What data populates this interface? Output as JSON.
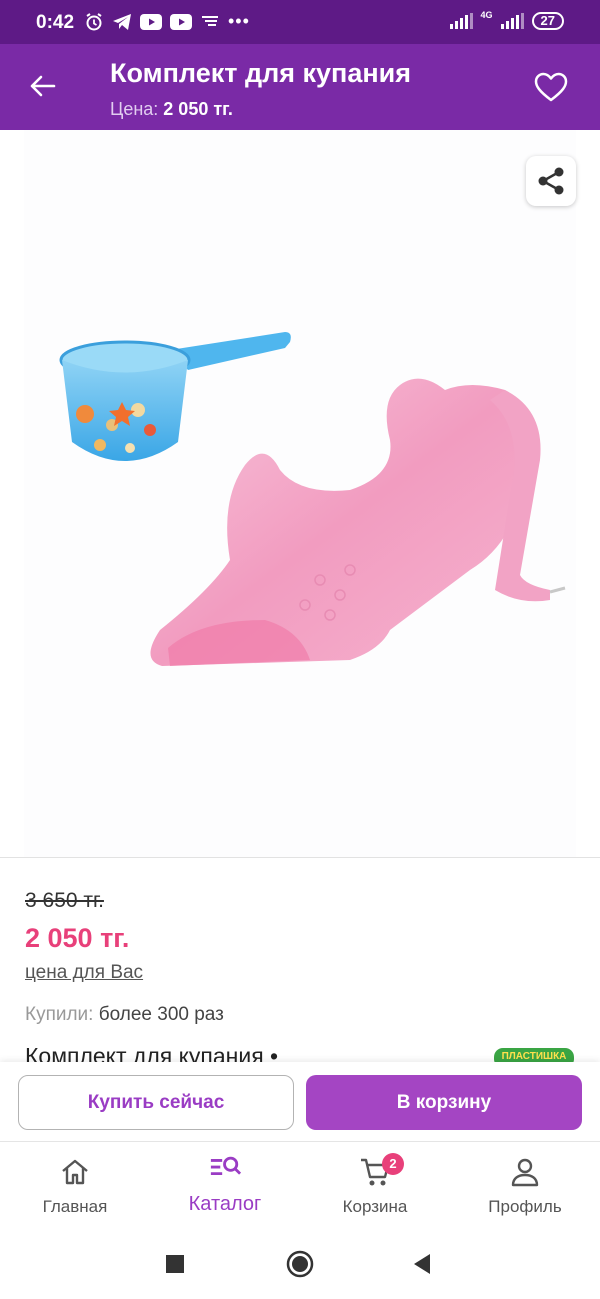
{
  "status_bar": {
    "time": "0:42",
    "left_icons": [
      "alarm-icon",
      "telegram-icon",
      "youtube-icon",
      "youtube-icon",
      "app-icon",
      "more-dots-icon"
    ],
    "network_label": "4G",
    "battery": "27"
  },
  "header": {
    "title": "Комплект для купания",
    "price_label": "Цена:",
    "price_value": "2 050 тг."
  },
  "product": {
    "old_price": "3 650 тг.",
    "new_price": "2 050 тг.",
    "your_price_link": "цена для Вас",
    "bought_label": "Купили:",
    "bought_value": "более 300 раз",
    "title_peek": "Комплект для купания •",
    "brand_logo": "Пластишка"
  },
  "actions": {
    "buy_now": "Купить сейчас",
    "add_to_cart": "В корзину"
  },
  "bottom_nav": {
    "items": [
      {
        "label": "Главная",
        "icon": "home-icon"
      },
      {
        "label": "Каталог",
        "icon": "catalog-search-icon",
        "active": true
      },
      {
        "label": "Корзина",
        "icon": "cart-icon",
        "badge": "2"
      },
      {
        "label": "Профиль",
        "icon": "profile-icon"
      }
    ]
  },
  "colors": {
    "header": "#7a2aa6",
    "status_bar": "#5e1a86",
    "accent": "#a445c3",
    "price": "#e8407a"
  }
}
